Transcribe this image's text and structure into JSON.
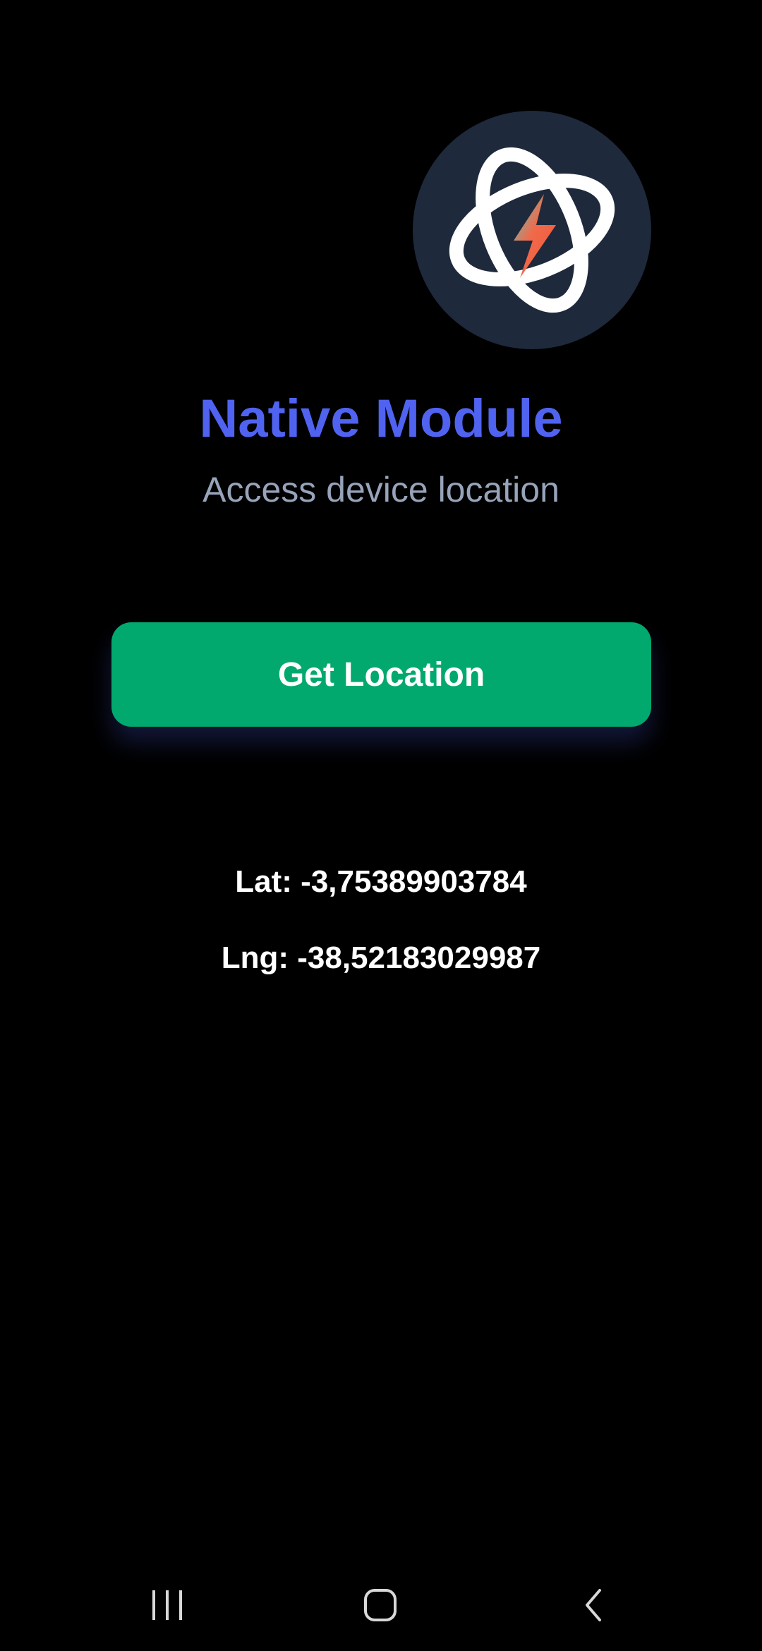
{
  "app": {
    "logo": {
      "icon": "atom-lightning-logo-icon",
      "background_color": "#1e293b"
    },
    "title": "Native Module",
    "subtitle": "Access device location",
    "button": {
      "label": "Get Location",
      "color": "#02a96f"
    },
    "location": {
      "lat_text": "Lat: -3,75389903784",
      "lng_text": "Lng: -38,52183029987"
    }
  },
  "colors": {
    "background": "#000000",
    "title": "#4f63f0",
    "subtitle": "#97a3b8",
    "text": "#ffffff"
  },
  "navigation_bar": {
    "buttons": [
      {
        "icon": "recents-icon"
      },
      {
        "icon": "home-icon"
      },
      {
        "icon": "back-icon"
      }
    ]
  }
}
